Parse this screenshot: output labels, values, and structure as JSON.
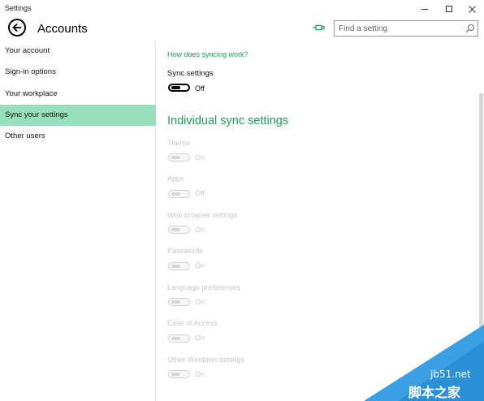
{
  "window": {
    "title": "Settings"
  },
  "header": {
    "title": "Accounts"
  },
  "search": {
    "placeholder": "Find a setting"
  },
  "sidebar": {
    "items": [
      {
        "label": "Your account",
        "active": false
      },
      {
        "label": "Sign-in options",
        "active": false
      },
      {
        "label": "Your workplace",
        "active": false
      },
      {
        "label": "Sync your settings",
        "active": true
      },
      {
        "label": "Other users",
        "active": false
      }
    ]
  },
  "content": {
    "help_link": "How does syncing work?",
    "sync_settings": {
      "label": "Sync settings",
      "state": "Off"
    },
    "section_heading": "Individual sync settings",
    "items": [
      {
        "label": "Theme",
        "state": "On"
      },
      {
        "label": "Apps",
        "state": "Off"
      },
      {
        "label": "Web browser settings",
        "state": "On"
      },
      {
        "label": "Passwords",
        "state": "On"
      },
      {
        "label": "Language preferences",
        "state": "On"
      },
      {
        "label": "Ease of Access",
        "state": "On"
      },
      {
        "label": "Other Windows settings",
        "state": "On"
      }
    ]
  },
  "watermark": {
    "site": "jb51.net",
    "name": "脚本之家"
  },
  "colors": {
    "accent": "#1e9e58",
    "nav_active": "#98dfbd",
    "disabled": "#c8c8c8",
    "watermark_blue": "#3aa0e4"
  }
}
